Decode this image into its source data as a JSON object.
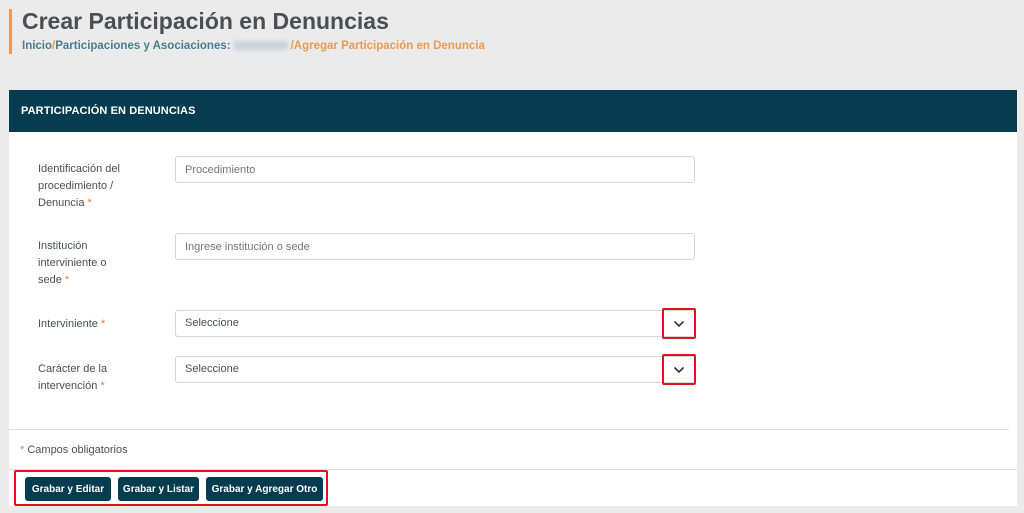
{
  "header": {
    "title": "Crear Participación en Denuncias",
    "breadcrumb": {
      "home": "Inicio",
      "separator": "/",
      "section": "Participaciones y Asociaciones:",
      "current": "Agregar Participación en Denuncia"
    }
  },
  "card": {
    "title": "PARTICIPACIÓN EN DENUNCIAS"
  },
  "form": {
    "required_marker": "*",
    "procedure": {
      "label": "Identificación del procedimiento / Denuncia",
      "placeholder": "Procedimiento"
    },
    "institution": {
      "label": "Institución interviniente o sede",
      "placeholder": "Ingrese institución o sede"
    },
    "intervener": {
      "label": "Interviniente",
      "value": "Seleccione"
    },
    "character": {
      "label": "Carácter de la intervención",
      "value": "Seleccione"
    },
    "mandatory_note": "Campos obligatorios"
  },
  "buttons": {
    "save_edit": "Grabar y Editar",
    "save_list": "Grabar y Listar",
    "save_add": "Grabar y Agregar Otro"
  },
  "colors": {
    "header_bar": "#053c50",
    "accent": "#e89a4f",
    "highlight": "#e0131f"
  }
}
